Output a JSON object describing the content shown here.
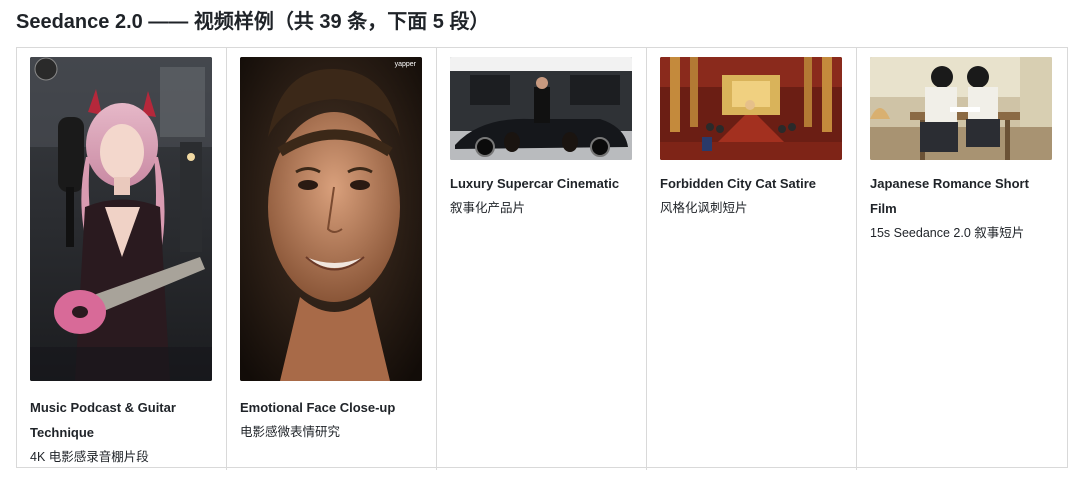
{
  "heading": "Seedance 2.0 —— 视频样例（共 39 条，下面 5 段）",
  "cards": [
    {
      "title": "Music Podcast & Guitar Technique",
      "tag": "4K 电影感录音棚片段",
      "thumb_icon": "musician-guitar-thumbnail"
    },
    {
      "title": "Emotional Face Close-up",
      "tag": "电影感微表情研究",
      "thumb_icon": "face-closeup-thumbnail",
      "watermark": "yapper"
    },
    {
      "title": "Luxury Supercar Cinematic",
      "tag": "叙事化产品片",
      "thumb_icon": "supercar-thumbnail"
    },
    {
      "title": "Forbidden City Cat Satire",
      "tag": "风格化讽刺短片",
      "thumb_icon": "palace-cats-thumbnail"
    },
    {
      "title": "Japanese Romance Short Film",
      "tag": "15s Seedance 2.0 叙事短片",
      "thumb_icon": "classroom-couple-thumbnail"
    }
  ]
}
